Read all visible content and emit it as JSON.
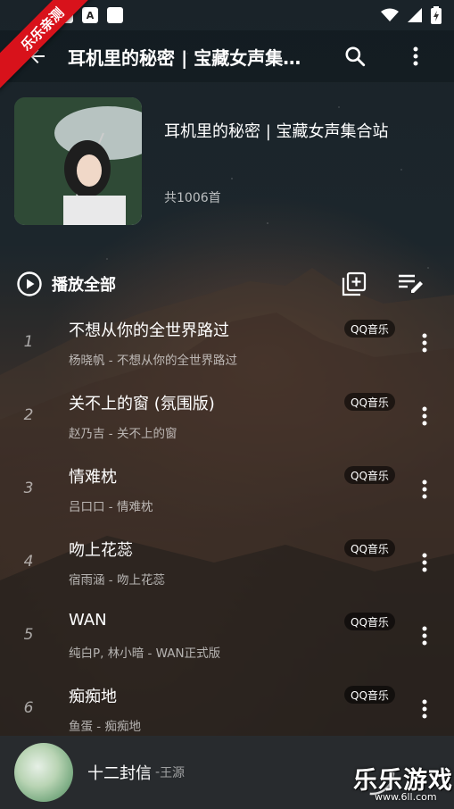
{
  "status_bar": {
    "time": "",
    "icons": [
      "notification-icon",
      "a-icon",
      "square-icon",
      "wifi-icon",
      "signal-icon",
      "battery-icon"
    ],
    "a_glyph": "A"
  },
  "corner_badge": {
    "text": "乐乐亲测",
    "color": "#d8121b"
  },
  "toolbar": {
    "title": "耳机里的秘密 | 宝藏女声集…"
  },
  "playlist": {
    "title": "耳机里的秘密 | 宝藏女声集合站",
    "count": "共1006首"
  },
  "actions": {
    "play_all": "播放全部"
  },
  "songs": [
    {
      "index": "1",
      "title": "不想从你的全世界路过",
      "subtitle": "杨晓帆 - 不想从你的全世界路过",
      "source": "QQ音乐"
    },
    {
      "index": "2",
      "title": "关不上的窗 (氛围版)",
      "subtitle": "赵乃吉 - 关不上的窗",
      "source": "QQ音乐"
    },
    {
      "index": "3",
      "title": "情难枕",
      "subtitle": "吕口口 - 情难枕",
      "source": "QQ音乐"
    },
    {
      "index": "4",
      "title": "吻上花蕊",
      "subtitle": "宿雨涵 - 吻上花蕊",
      "source": "QQ音乐"
    },
    {
      "index": "5",
      "title": "WAN",
      "subtitle": "纯白P, 林小暗 - WAN正式版",
      "source": "QQ音乐"
    },
    {
      "index": "6",
      "title": "痴痴地",
      "subtitle": "鱼蛋 - 痴痴地",
      "source": "QQ音乐"
    }
  ],
  "player": {
    "song": "十二封信",
    "separator": "-",
    "artist": "王源"
  },
  "watermark": {
    "text": "乐乐游戏",
    "url": "www.6ll.com"
  }
}
